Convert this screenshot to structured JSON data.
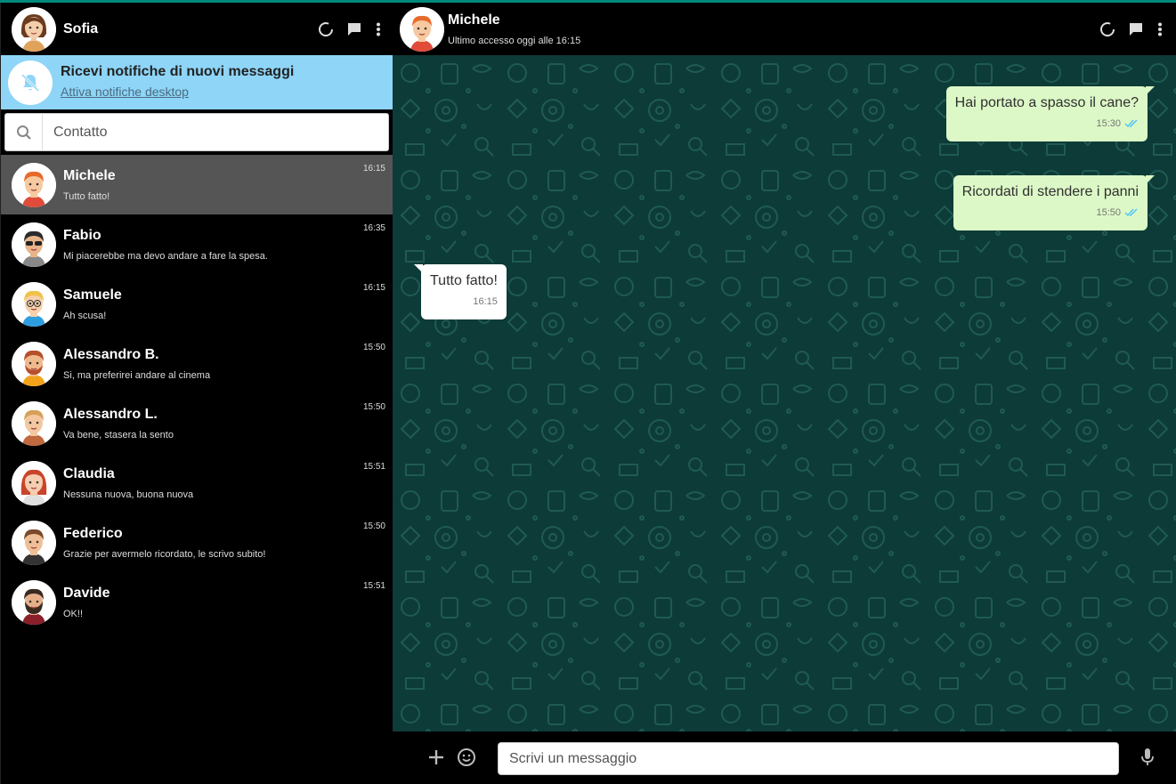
{
  "me": {
    "name": "Sofia",
    "avatar": "avatar-sofia"
  },
  "header_icons": [
    "status-icon",
    "new-chat-icon",
    "menu-icon"
  ],
  "notification": {
    "title": "Ricevi notifiche di nuovi messaggi",
    "link": "Attiva notifiche desktop",
    "icon": "bell-off-icon"
  },
  "search": {
    "placeholder": "Contatto",
    "icon": "search-icon"
  },
  "contacts": [
    {
      "name": "Michele",
      "message": "Tutto fatto!",
      "time": "16:15",
      "active": true
    },
    {
      "name": "Fabio",
      "message": "Mi piacerebbe ma devo andare a fare la spesa.",
      "time": "16:35"
    },
    {
      "name": "Samuele",
      "message": "Ah scusa!",
      "time": "16:15"
    },
    {
      "name": "Alessandro B.",
      "message": "Si, ma preferirei andare al cinema",
      "time": "15:50"
    },
    {
      "name": "Alessandro L.",
      "message": "Va bene, stasera la sento",
      "time": "15:50"
    },
    {
      "name": "Claudia",
      "message": "Nessuna nuova, buona nuova",
      "time": "15:51"
    },
    {
      "name": "Federico",
      "message": "Grazie per avermelo ricordato, le scrivo subito!",
      "time": "15:50"
    },
    {
      "name": "Davide",
      "message": "OK!!",
      "time": "15:51"
    }
  ],
  "chat": {
    "name": "Michele",
    "status": "Ultimo accesso oggi alle 16:15",
    "messages": [
      {
        "text": "Hai portato a spasso il cane?",
        "time": "15:30",
        "direction": "out",
        "read": true
      },
      {
        "text": "Ricordati di stendere i panni",
        "time": "15:50",
        "direction": "out",
        "read": true
      },
      {
        "text": "Tutto fatto!",
        "time": "16:15",
        "direction": "in"
      }
    ]
  },
  "composer": {
    "placeholder": "Scrivi un messaggio",
    "icons": [
      "plus-icon",
      "emoji-icon",
      "microphone-icon"
    ]
  },
  "colors": {
    "accent": "#00897b",
    "notification_bg": "#8ed5f8",
    "outgoing_bubble": "#dcf8c6",
    "incoming_bubble": "#ffffff",
    "chat_bg": "#0d3b37",
    "active_contact_bg": "#555555",
    "read_tick": "#4fc3f7"
  }
}
